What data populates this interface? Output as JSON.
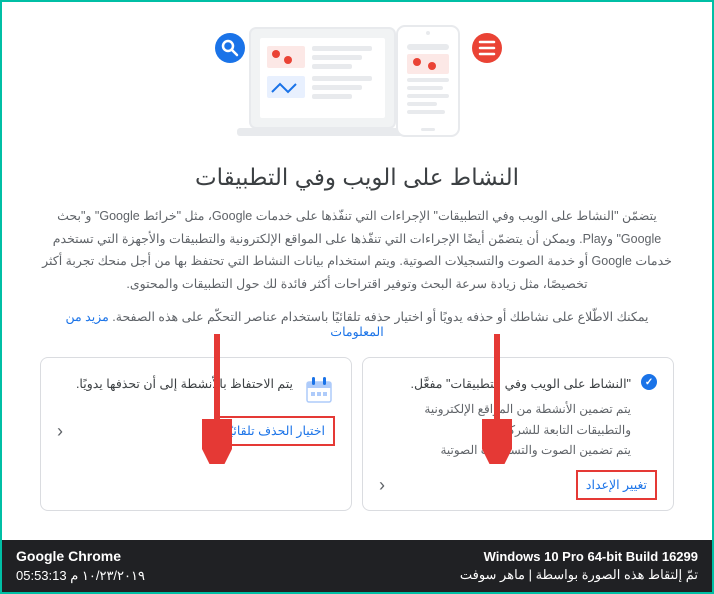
{
  "hero": {
    "search_icon": "search-icon",
    "list_icon": "list-icon"
  },
  "title": "النشاط على الويب وفي التطبيقات",
  "description": "يتضمّن \"النشاط على الويب وفي التطبيقات\" الإجراءات التي تنفّذها على خدمات Google، مثل \"خرائط Google\" و\"بحث Google\" وPlay. ويمكن أن يتضمّن أيضًا الإجراءات التي تنفّذها على المواقع الإلكترونية والتطبيقات والأجهزة التي تستخدم خدمات Google أو خدمة الصوت والتسجيلات الصوتية. ويتم استخدام بيانات النشاط التي تحتفظ بها من أجل منحك تجربة أكثر تخصيصًا، مثل زيادة سرعة البحث وتوفير اقتراحات أكثر فائدة لك حول التطبيقات والمحتوى.",
  "sub_description": "يمكنك الاطّلاع على نشاطك أو حذفه يدويًا أو اختيار حذفه تلقائيًا باستخدام عناصر التحكّم على هذه الصفحة.",
  "more_info_link": "مزيد من المعلومات",
  "cards": {
    "status": {
      "title": "\"النشاط على الويب وفي التطبيقات\" مفعَّل.",
      "line1": "يتم تضمين الأنشطة من المواقع الإلكترونية والتطبيقات التابعة للشركاء",
      "line2": "يتم تضمين الصوت والتسجيلات الصوتية",
      "action": "تغيير الإعداد"
    },
    "retention": {
      "title": "يتم الاحتفاظ بالأنشطة إلى أن تحذفها يدويًا.",
      "action": "اختيار الحذف تلقائيًا"
    }
  },
  "footer": {
    "browser": "Google Chrome",
    "time": "05:53:13 ١٠/٢٣/٢٠١٩ م",
    "os": "Windows 10 Pro 64-bit Build 16299",
    "credit": "تمّ إلتقاط هذه الصورة بواسطة | ماهر سوفت"
  }
}
